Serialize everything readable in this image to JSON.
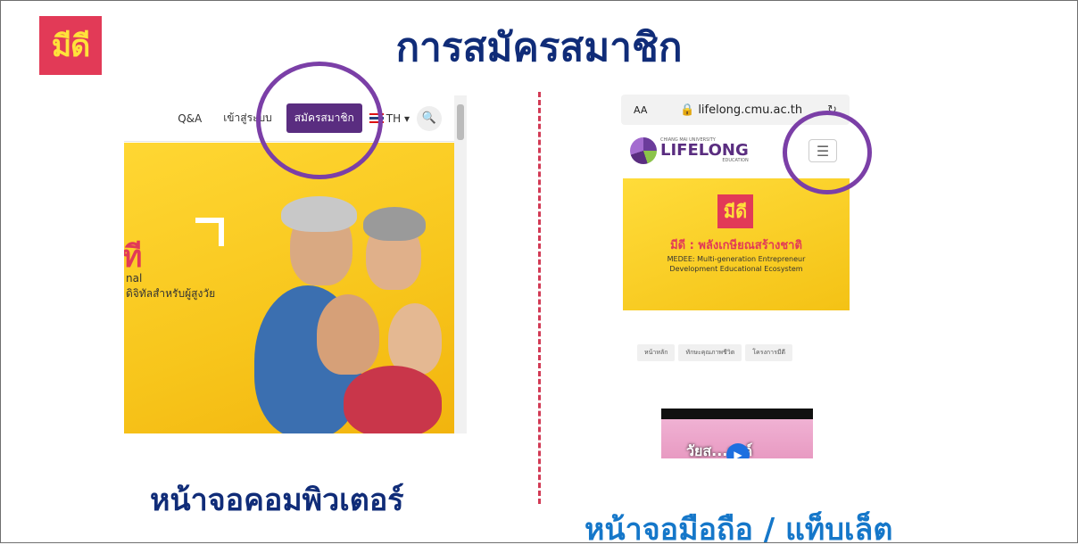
{
  "logo": {
    "text": "มีดี"
  },
  "title": "การสมัครสมาชิก",
  "desktop": {
    "nav": {
      "qa": "Q&A",
      "login": "เข้าสู่ระบบ",
      "signup": "สมัครสมาชิก",
      "lang": "TH ▾",
      "search_icon": "🔍"
    },
    "hero": {
      "title_fragment": "ที",
      "line1": "nal",
      "line2": "ดิจิทัลสำหรับผู้สูงวัย"
    }
  },
  "mobile": {
    "url": {
      "aa": "AA",
      "domain": "🔒 lifelong.cmu.ac.th",
      "reload": "↻"
    },
    "brand": {
      "small": "CHIANG MAI UNIVERSITY",
      "big": "LIFELONG",
      "edu": "EDUCATION"
    },
    "menu_icon": "☰",
    "hero": {
      "logo": "มีดี",
      "headline": "มีดี : พลังเกษียณสร้างชาติ",
      "sub1": "MEDEE: Multi-generation Entrepreneur",
      "sub2": "Development Educational Ecosystem"
    },
    "breadcrumbs": [
      "หน้าหลัก",
      "ทักษะคุณภาพชีวิต",
      "โครงการมีดี"
    ],
    "video": {
      "text": "วัยส...รรค์",
      "play": "▶"
    }
  },
  "captions": {
    "desktop": "หน้าจอคอมพิวเตอร์",
    "mobile": "หน้าจอมือถือ / แท็บเล็ต"
  },
  "colors": {
    "title": "#102c78",
    "mobile_caption": "#1577c9",
    "highlight_circle": "#7b3fa7",
    "brand_red": "#e23a57",
    "brand_yellow": "#ffe23a",
    "signup_button": "#5a2d80"
  }
}
